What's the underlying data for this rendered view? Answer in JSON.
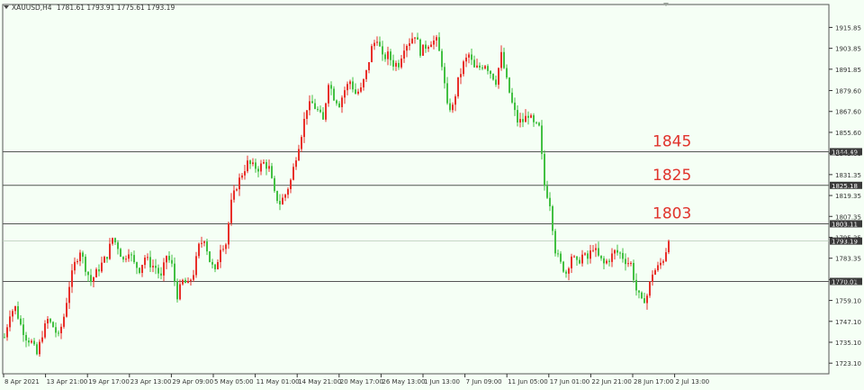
{
  "window": {
    "symbol_label": "XAUUSD,H4",
    "ohlc_label": "1781.61 1793.91 1775.61 1793.19"
  },
  "colors": {
    "background": "#f5fff5",
    "bull": "#e8302a",
    "bear": "#43c043",
    "level_line": "#555555",
    "annotation": "#e0332b",
    "axis": "#333333"
  },
  "chart_data": {
    "type": "candlestick",
    "symbol": "XAUUSD",
    "timeframe": "H4",
    "ylim": [
      1717,
      1929
    ],
    "y_ticks": [
      1915.85,
      1903.85,
      1891.85,
      1879.6,
      1867.6,
      1855.6,
      1843.6,
      1831.35,
      1819.35,
      1807.35,
      1795.35,
      1783.35,
      1771.1,
      1759.1,
      1747.1,
      1735.1,
      1723.1
    ],
    "x_ticks": [
      "8 Apr 2021",
      "13 Apr 21:00",
      "19 Apr 17:00",
      "23 Apr 13:00",
      "29 Apr 09:00",
      "5 May 05:00",
      "11 May 01:00",
      "14 May 21:00",
      "20 May 17:00",
      "26 May 13:00",
      "1 Jun 13:00",
      "7 Jun 09:00",
      "11 Jun 05:00",
      "17 Jun 01:00",
      "22 Jun 21:00",
      "28 Jun 17:00",
      "2 Jul 13:00"
    ],
    "levels": [
      {
        "price": 1844.49,
        "label": "1844.49",
        "annotation": "1845"
      },
      {
        "price": 1825.18,
        "label": "1825.18",
        "annotation": "1825"
      },
      {
        "price": 1803.11,
        "label": "1803.11",
        "annotation": "1803"
      },
      {
        "price": 1770.01,
        "label": "1770.01",
        "annotation": ""
      }
    ],
    "current_price": {
      "price": 1793.19,
      "label": "1793.19"
    },
    "path": [
      [
        0,
        1738
      ],
      [
        6,
        1752
      ],
      [
        12,
        1755
      ],
      [
        18,
        1745
      ],
      [
        24,
        1738
      ],
      [
        30,
        1735
      ],
      [
        36,
        1728
      ],
      [
        42,
        1740
      ],
      [
        48,
        1748
      ],
      [
        54,
        1744
      ],
      [
        60,
        1738
      ],
      [
        66,
        1750
      ],
      [
        72,
        1768
      ],
      [
        78,
        1780
      ],
      [
        84,
        1788
      ],
      [
        90,
        1778
      ],
      [
        96,
        1770
      ],
      [
        102,
        1775
      ],
      [
        108,
        1780
      ],
      [
        114,
        1785
      ],
      [
        120,
        1795
      ],
      [
        126,
        1790
      ],
      [
        132,
        1782
      ],
      [
        138,
        1788
      ],
      [
        144,
        1780
      ],
      [
        150,
        1777
      ],
      [
        156,
        1784
      ],
      [
        162,
        1780
      ],
      [
        168,
        1778
      ],
      [
        174,
        1772
      ],
      [
        180,
        1785
      ],
      [
        186,
        1779
      ],
      [
        192,
        1762
      ],
      [
        198,
        1770
      ],
      [
        204,
        1768
      ],
      [
        210,
        1775
      ],
      [
        216,
        1790
      ],
      [
        222,
        1795
      ],
      [
        228,
        1782
      ],
      [
        234,
        1775
      ],
      [
        240,
        1790
      ],
      [
        246,
        1792
      ],
      [
        252,
        1815
      ],
      [
        258,
        1825
      ],
      [
        264,
        1832
      ],
      [
        270,
        1838
      ],
      [
        276,
        1836
      ],
      [
        282,
        1835
      ],
      [
        288,
        1838
      ],
      [
        294,
        1835
      ],
      [
        300,
        1820
      ],
      [
        306,
        1815
      ],
      [
        312,
        1820
      ],
      [
        318,
        1828
      ],
      [
        324,
        1842
      ],
      [
        330,
        1855
      ],
      [
        336,
        1870
      ],
      [
        342,
        1872
      ],
      [
        348,
        1868
      ],
      [
        354,
        1862
      ],
      [
        360,
        1885
      ],
      [
        366,
        1876
      ],
      [
        372,
        1872
      ],
      [
        378,
        1880
      ],
      [
        384,
        1885
      ],
      [
        390,
        1878
      ],
      [
        396,
        1880
      ],
      [
        402,
        1890
      ],
      [
        408,
        1904
      ],
      [
        414,
        1910
      ],
      [
        420,
        1898
      ],
      [
        426,
        1900
      ],
      [
        432,
        1895
      ],
      [
        438,
        1895
      ],
      [
        444,
        1905
      ],
      [
        450,
        1908
      ],
      [
        456,
        1912
      ],
      [
        462,
        1902
      ],
      [
        468,
        1905
      ],
      [
        474,
        1908
      ],
      [
        480,
        1908
      ],
      [
        486,
        1895
      ],
      [
        492,
        1870
      ],
      [
        498,
        1870
      ],
      [
        504,
        1885
      ],
      [
        510,
        1895
      ],
      [
        516,
        1900
      ],
      [
        522,
        1892
      ],
      [
        528,
        1893
      ],
      [
        534,
        1895
      ],
      [
        540,
        1890
      ],
      [
        546,
        1885
      ],
      [
        552,
        1900
      ],
      [
        558,
        1885
      ],
      [
        564,
        1872
      ],
      [
        570,
        1862
      ],
      [
        576,
        1862
      ],
      [
        582,
        1866
      ],
      [
        588,
        1860
      ],
      [
        594,
        1858
      ],
      [
        600,
        1825
      ],
      [
        606,
        1815
      ],
      [
        612,
        1788
      ],
      [
        618,
        1780
      ],
      [
        624,
        1775
      ],
      [
        630,
        1785
      ],
      [
        636,
        1780
      ],
      [
        642,
        1785
      ],
      [
        648,
        1783
      ],
      [
        654,
        1790
      ],
      [
        660,
        1784
      ],
      [
        666,
        1780
      ],
      [
        672,
        1783
      ],
      [
        678,
        1787
      ],
      [
        684,
        1786
      ],
      [
        690,
        1782
      ],
      [
        696,
        1780
      ],
      [
        702,
        1765
      ],
      [
        708,
        1758
      ],
      [
        714,
        1762
      ],
      [
        720,
        1775
      ],
      [
        726,
        1778
      ],
      [
        732,
        1783
      ],
      [
        738,
        1793
      ]
    ]
  }
}
